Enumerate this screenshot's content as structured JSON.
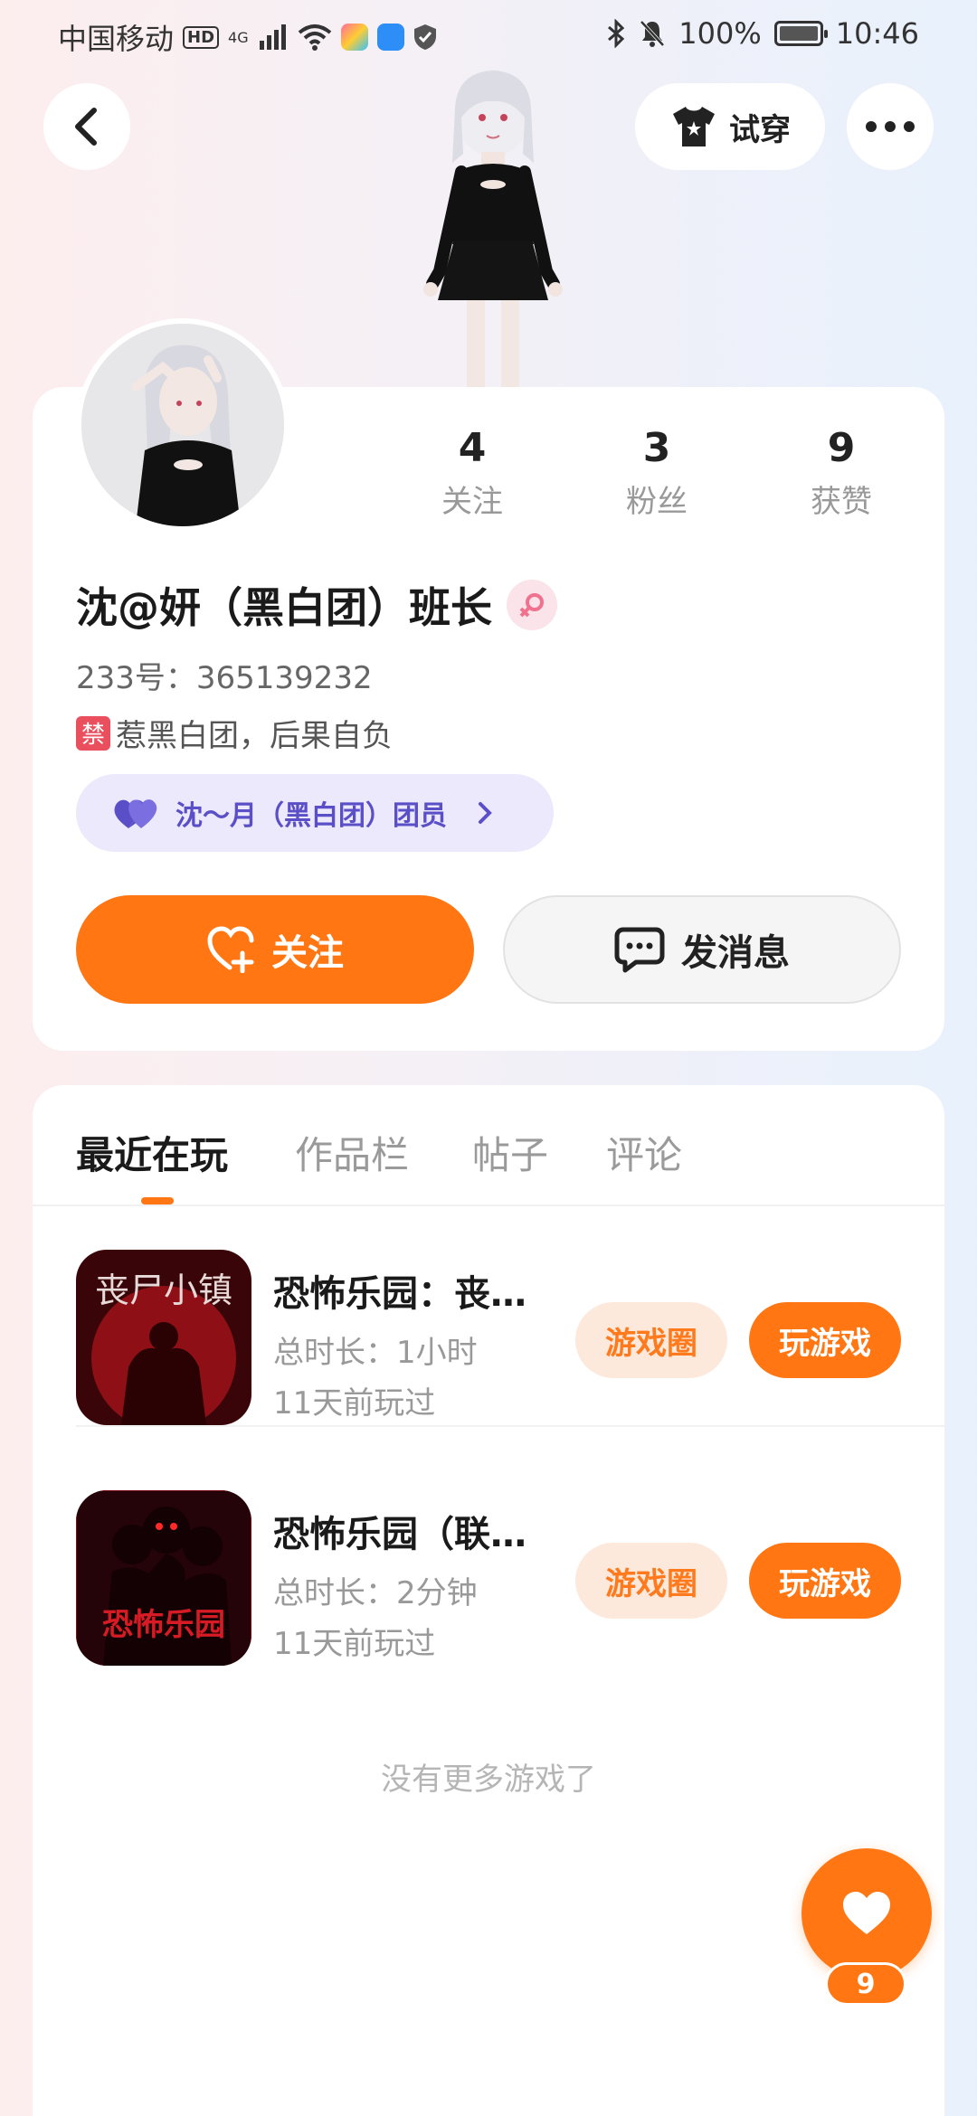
{
  "status_bar": {
    "carrier": "中国移动",
    "hd": "HD",
    "network": "4G",
    "battery": "100%",
    "time": "10:46"
  },
  "header": {
    "tryon_label": "试穿"
  },
  "profile": {
    "username": "沈@妍（黑白团）班长",
    "uid": "233号：365139232",
    "bio_badge": "禁",
    "bio": "惹黑白团，后果自负",
    "group_tag": "沈～月（黑白团）团员",
    "stats": [
      {
        "num": "4",
        "label": "关注"
      },
      {
        "num": "3",
        "label": "粉丝"
      },
      {
        "num": "9",
        "label": "获赞"
      }
    ],
    "follow_label": "关注",
    "message_label": "发消息"
  },
  "tabs": [
    {
      "label": "最近在玩"
    },
    {
      "label": "作品栏"
    },
    {
      "label": "帖子"
    },
    {
      "label": "评论"
    }
  ],
  "games": [
    {
      "title": "恐怖乐园：丧…",
      "duration": "总时长：1小时",
      "last_played": "11天前玩过",
      "icon_text": "丧尸小镇",
      "circle_label": "游戏圈",
      "play_label": "玩游戏"
    },
    {
      "title": "恐怖乐园（联…",
      "duration": "总时长：2分钟",
      "last_played": "11天前玩过",
      "icon_text": "恐怖乐园",
      "circle_label": "游戏圈",
      "play_label": "玩游戏"
    }
  ],
  "no_more": "没有更多游戏了",
  "like": {
    "count": "9"
  },
  "colors": {
    "accent": "#ff7613",
    "tag_bg": "#ebe9fb",
    "tag_text": "#5b4fc7"
  }
}
